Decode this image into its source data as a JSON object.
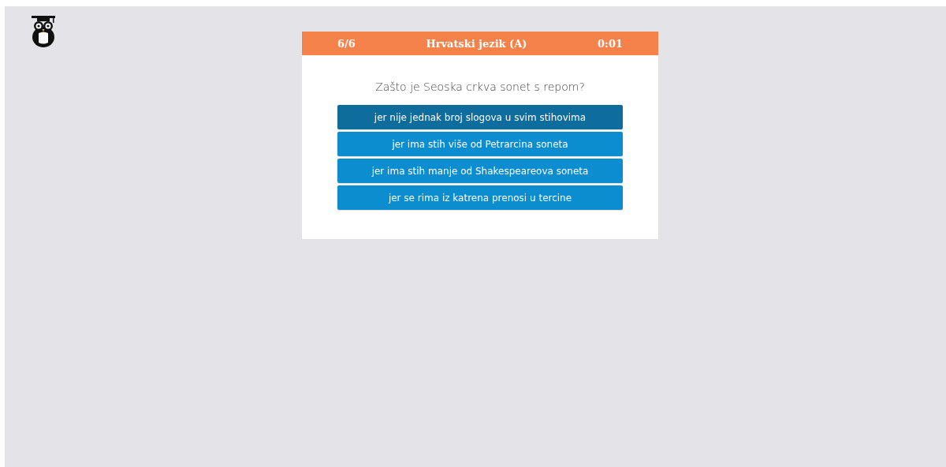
{
  "quiz": {
    "progress": "6/6",
    "title": "Hrvatski jezik (A)",
    "timer": "0:01"
  },
  "question": "Zašto je Seoska crkva sonet s repom?",
  "answers": [
    {
      "label": "jer nije jednak broj slogova u svim stihovima",
      "selected": true
    },
    {
      "label": "jer ima stih više od Petrarcina soneta",
      "selected": false
    },
    {
      "label": "jer ima stih manje od Shakespeareova soneta",
      "selected": false
    },
    {
      "label": "jer se rima iz katrena prenosi u tercine",
      "selected": false
    }
  ]
}
